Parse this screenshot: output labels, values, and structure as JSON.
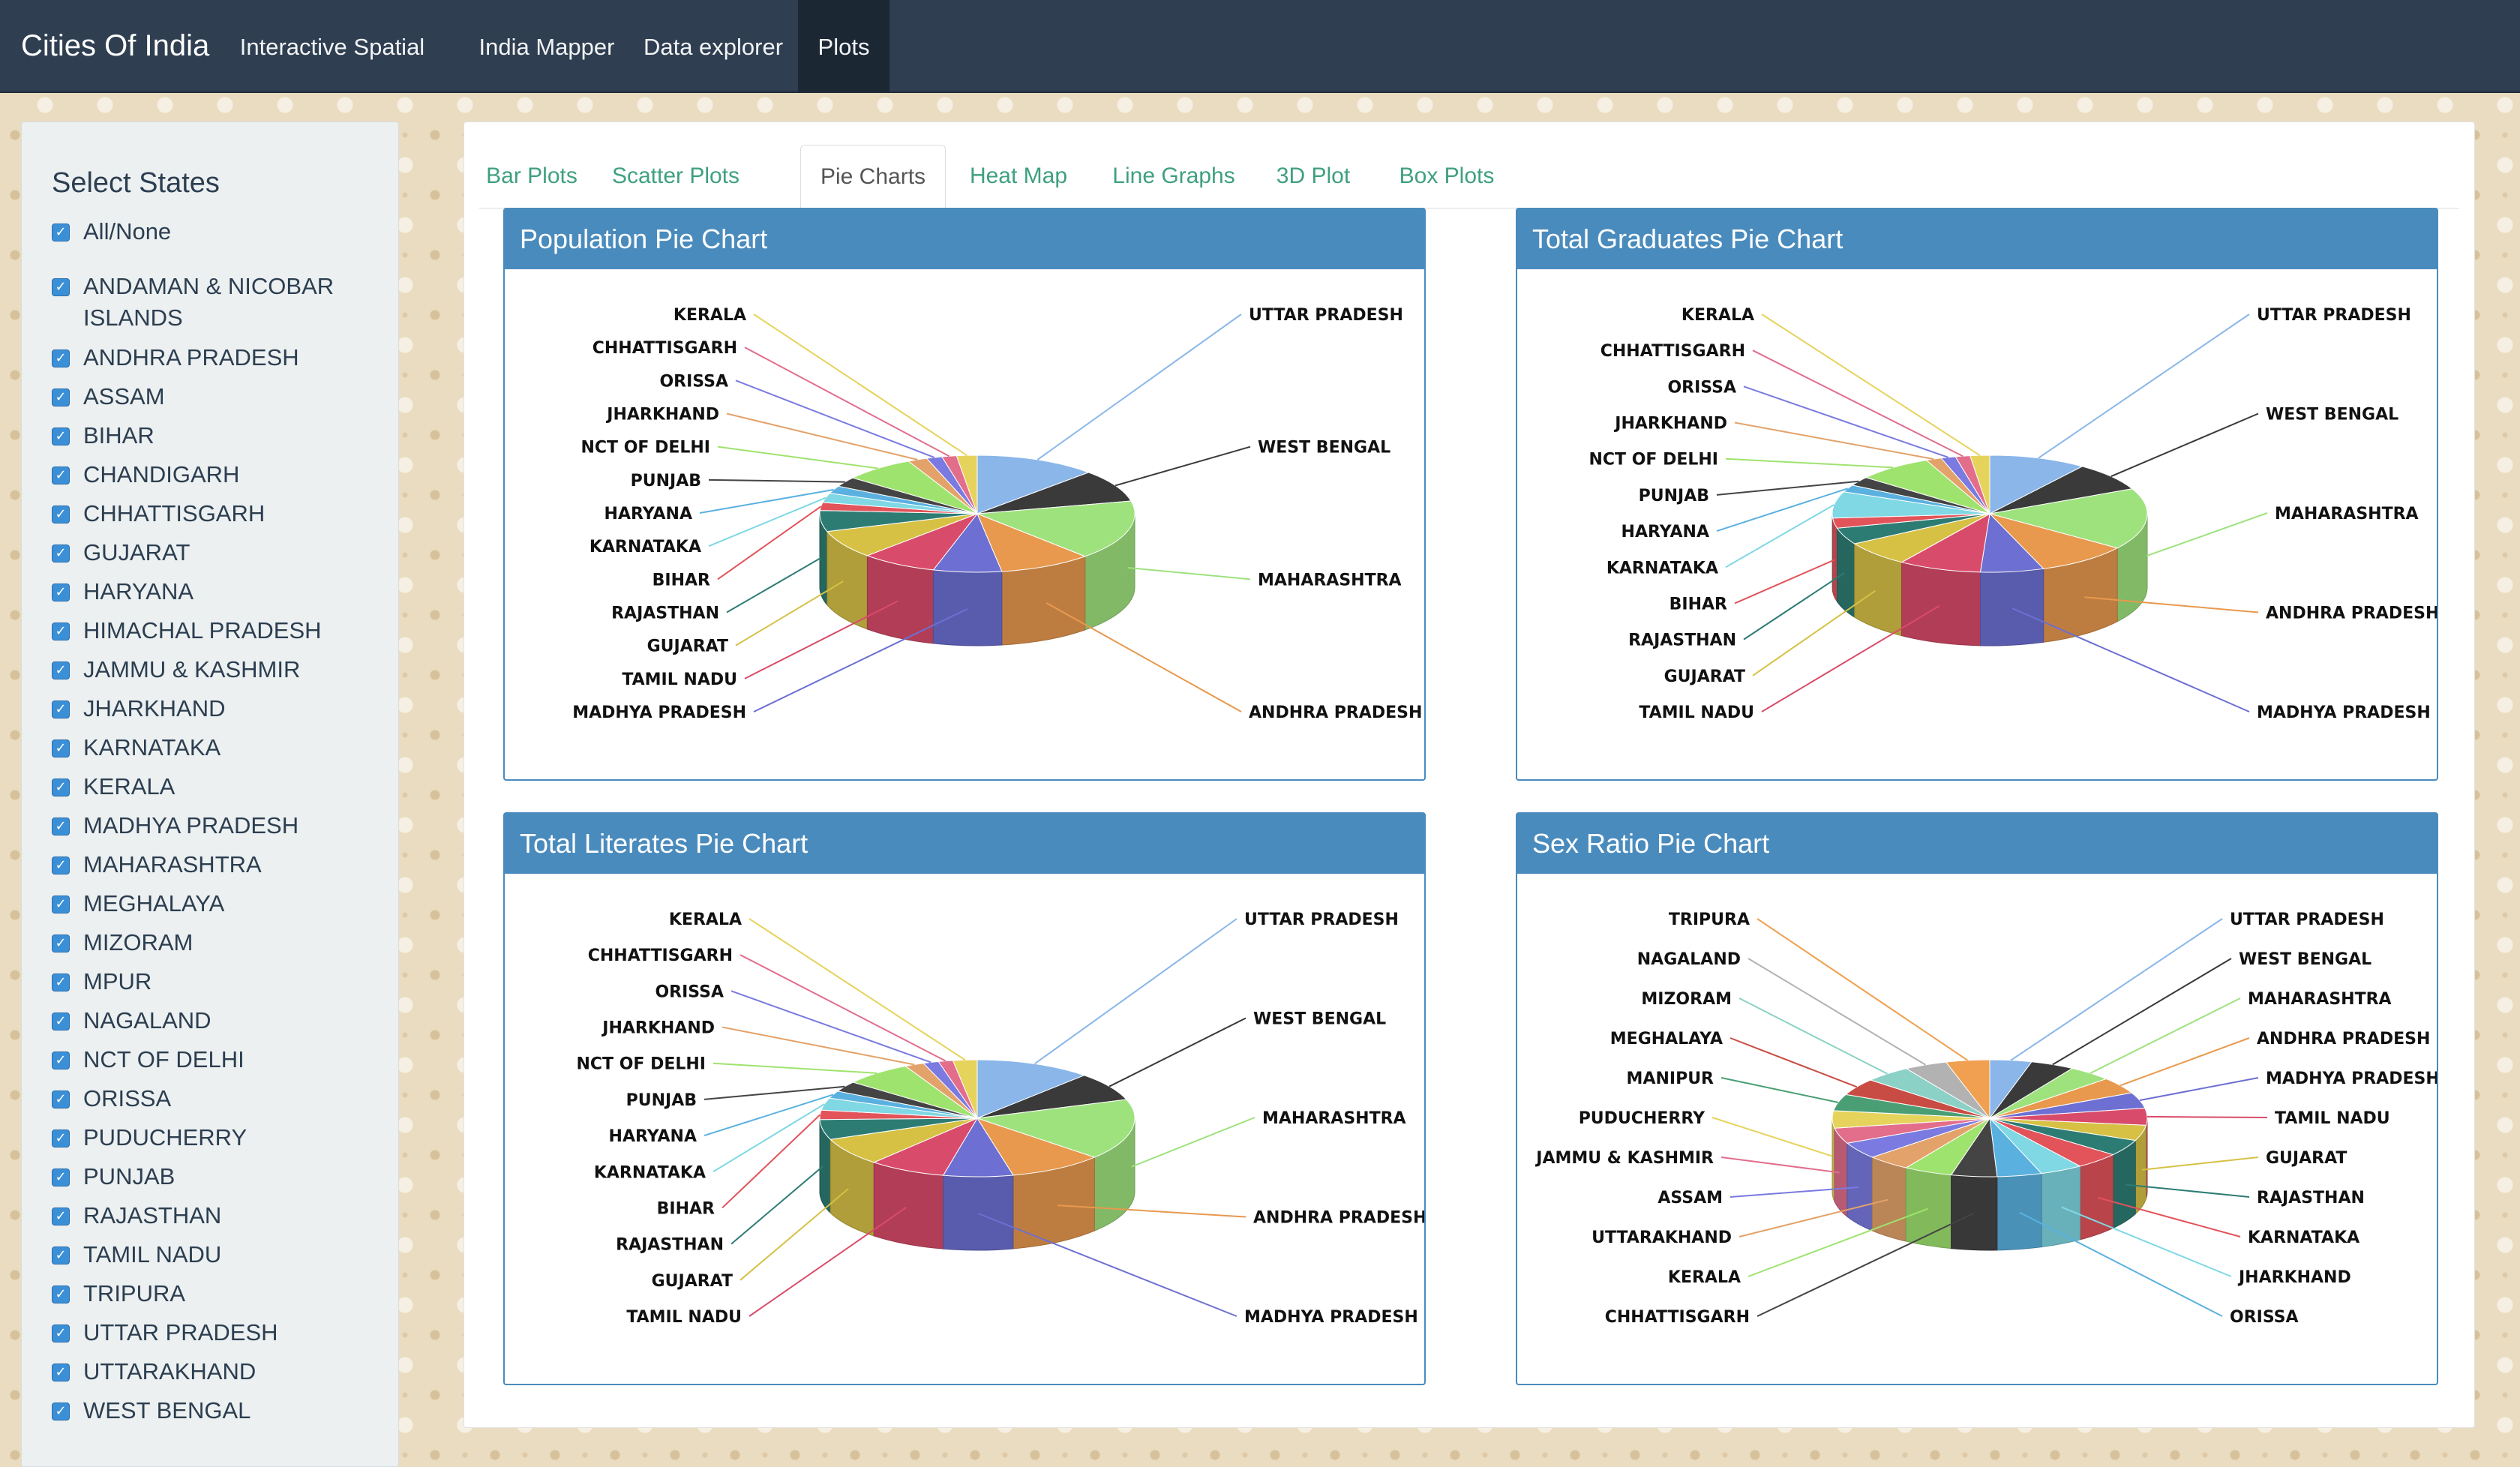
{
  "navbar": {
    "brand": "Cities Of India",
    "items": [
      "Interactive Spatial map",
      "India Mapper",
      "Data explorer",
      "Plots"
    ],
    "active": "Plots"
  },
  "sidebar": {
    "title": "Select States",
    "all_none": "All/None",
    "states": [
      "ANDAMAN & NICOBAR ISLANDS",
      "ANDHRA PRADESH",
      "ASSAM",
      "BIHAR",
      "CHANDIGARH",
      "CHHATTISGARH",
      "GUJARAT",
      "HARYANA",
      "HIMACHAL PRADESH",
      "JAMMU & KASHMIR",
      "JHARKHAND",
      "KARNATAKA",
      "KERALA",
      "MADHYA PRADESH",
      "MAHARASHTRA",
      "MEGHALAYA",
      "MIZORAM",
      "MPUR",
      "NAGALAND",
      "NCT OF DELHI",
      "ORISSA",
      "PUDUCHERRY",
      "PUNJAB",
      "RAJASTHAN",
      "TAMIL NADU",
      "TRIPURA",
      "UTTAR PRADESH",
      "UTTARAKHAND",
      "WEST BENGAL"
    ]
  },
  "tabs": [
    "Bar Plots",
    "Scatter Plots",
    "Pie Charts",
    "Heat Map",
    "Line Graphs",
    "3D Plot",
    "Box Plots"
  ],
  "active_tab": "Pie Charts",
  "chart_data": [
    {
      "type": "pie",
      "title": "Population Pie Chart",
      "categories": [
        "UTTAR PRADESH",
        "WEST BENGAL",
        "MAHARASHTRA",
        "ANDHRA PRADESH",
        "MADHYA PRADESH",
        "TAMIL NADU",
        "GUJARAT",
        "RAJASTHAN",
        "BIHAR",
        "KARNATAKA",
        "HARYANA",
        "PUNJAB",
        "NCT OF DELHI",
        "JHARKHAND",
        "ORISSA",
        "CHHATTISGARH",
        "KERALA"
      ],
      "values": [
        12.5,
        9.0,
        16.5,
        9.5,
        7.0,
        7.8,
        7.8,
        5.8,
        2.2,
        2.6,
        2.1,
        2.7,
        7.3,
        2.0,
        1.6,
        1.5,
        2.1
      ]
    },
    {
      "type": "pie",
      "title": "Total Graduates Pie Chart",
      "categories": [
        "UTTAR PRADESH",
        "WEST BENGAL",
        "MAHARASHTRA",
        "ANDHRA PRADESH",
        "MADHYA PRADESH",
        "TAMIL NADU",
        "GUJARAT",
        "RAJASTHAN",
        "BIHAR",
        "KARNATAKA",
        "HARYANA",
        "PUNJAB",
        "NCT OF DELHI",
        "JHARKHAND",
        "ORISSA",
        "CHHATTISGARH",
        "KERALA"
      ],
      "values": [
        10.0,
        8.0,
        17.0,
        9.5,
        6.5,
        8.5,
        7.0,
        4.6,
        2.8,
        7.3,
        2.0,
        2.5,
        7.8,
        1.6,
        1.5,
        1.5,
        2.0
      ]
    },
    {
      "type": "pie",
      "title": "Total Literates Pie Chart",
      "categories": [
        "UTTAR PRADESH",
        "WEST BENGAL",
        "MAHARASHTRA",
        "ANDHRA PRADESH",
        "MADHYA PRADESH",
        "TAMIL NADU",
        "GUJARAT",
        "RAJASTHAN",
        "BIHAR",
        "KARNATAKA",
        "HARYANA",
        "PUNJAB",
        "NCT OF DELHI",
        "JHARKHAND",
        "ORISSA",
        "CHHATTISGARH",
        "KERALA"
      ],
      "values": [
        12.0,
        8.0,
        17.0,
        9.8,
        7.2,
        8.0,
        7.8,
        5.6,
        2.6,
        3.4,
        2.1,
        2.9,
        7.0,
        2.0,
        1.6,
        1.5,
        2.5
      ]
    },
    {
      "type": "pie",
      "title": "Sex Ratio Pie Chart",
      "categories": [
        "UTTAR PRADESH",
        "WEST BENGAL",
        "MAHARASHTRA",
        "ANDHRA PRADESH",
        "MADHYA PRADESH",
        "TAMIL NADU",
        "GUJARAT",
        "RAJASTHAN",
        "KARNATAKA",
        "JHARKHAND",
        "ORISSA",
        "CHHATTISGARH",
        "KERALA",
        "UTTARAKHAND",
        "ASSAM",
        "JAMMU & KASHMIR",
        "PUDUCHERRY",
        "MANIPUR",
        "MEGHALAYA",
        "MIZORAM",
        "NAGALAND",
        "TRIPURA"
      ],
      "values": [
        4.3,
        4.5,
        4.5,
        4.6,
        4.4,
        4.7,
        4.3,
        4.5,
        4.6,
        4.4,
        4.6,
        4.7,
        5.0,
        4.5,
        4.6,
        4.3,
        4.8,
        4.6,
        4.7,
        4.8,
        4.4,
        4.5
      ]
    }
  ],
  "colors": [
    "#8ab6ea",
    "#3a3a3a",
    "#9ee27e",
    "#e8994e",
    "#6d6fd2",
    "#d94b6a",
    "#d6c145",
    "#2d7c74",
    "#e2535a",
    "#7fd8e4",
    "#5ab1e0",
    "#444444",
    "#9fe36f",
    "#e3a26a",
    "#7a7ae0",
    "#e26e8c",
    "#e6d35c",
    "#4a9e74",
    "#c84c44",
    "#8cd1c6",
    "#b2b2b2",
    "#f0a050"
  ]
}
